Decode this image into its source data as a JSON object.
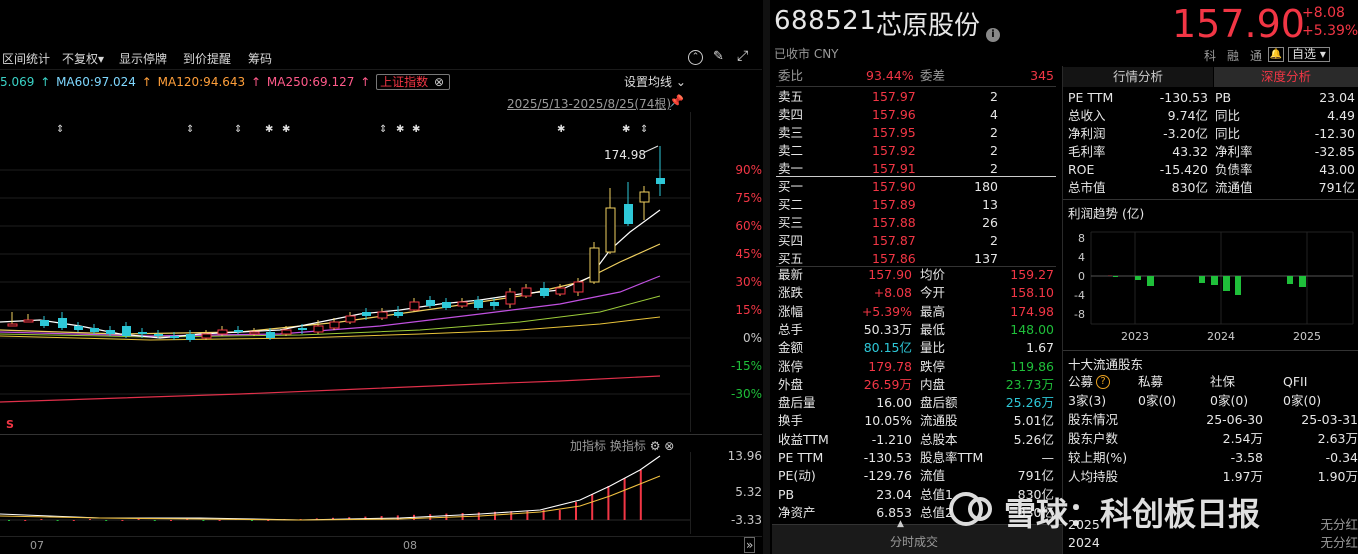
{
  "toolbar": {
    "items": [
      "区间统计",
      "不复权",
      "显示停牌",
      "到价提醒",
      "筹码"
    ],
    "not_adjusted_arrow": "▾"
  },
  "ma_legend": {
    "ma_prev": "5.069",
    "ma60": "MA60:97.024",
    "ma120": "MA120:94.643",
    "ma250": "MA250:69.127",
    "index_btn": "上证指数",
    "settings": "设置均线"
  },
  "chart": {
    "range_label": "2025/5/13-2025/8/25(74根)",
    "high_label": "174.98",
    "pct_ticks": [
      "90%",
      "75%",
      "60%",
      "45%",
      "30%",
      "15%",
      "0%",
      "-15%",
      "-30%"
    ],
    "indicator_buttons": [
      "加指标",
      "换指标"
    ],
    "sub_ticks": [
      "13.96",
      "5.32",
      "-3.33"
    ],
    "x_labels": [
      "07",
      "08"
    ],
    "s_mark": "S"
  },
  "quote": {
    "code": "688521",
    "name": "芯原股份",
    "status": "已收市 CNY",
    "price": "157.90",
    "change": "+8.08",
    "change_pct": "+5.39%",
    "tags": [
      "科",
      "融",
      "通"
    ],
    "watchlist": "自选"
  },
  "order_book": {
    "weibi_label": "委比",
    "weibi_val": "93.44%",
    "weicha_label": "委差",
    "weicha_val": "345",
    "asks": [
      {
        "label": "卖五",
        "price": "157.97",
        "vol": "2"
      },
      {
        "label": "卖四",
        "price": "157.96",
        "vol": "4"
      },
      {
        "label": "卖三",
        "price": "157.95",
        "vol": "2"
      },
      {
        "label": "卖二",
        "price": "157.92",
        "vol": "2"
      },
      {
        "label": "卖一",
        "price": "157.91",
        "vol": "2"
      }
    ],
    "bids": [
      {
        "label": "买一",
        "price": "157.90",
        "vol": "180"
      },
      {
        "label": "买二",
        "price": "157.89",
        "vol": "13"
      },
      {
        "label": "买三",
        "price": "157.88",
        "vol": "26"
      },
      {
        "label": "买四",
        "price": "157.87",
        "vol": "2"
      },
      {
        "label": "买五",
        "price": "157.86",
        "vol": "137"
      }
    ]
  },
  "stats": [
    {
      "l1": "最新",
      "v1": "157.90",
      "c1": "red",
      "l2": "均价",
      "v2": "159.27",
      "c2": "red"
    },
    {
      "l1": "涨跌",
      "v1": "+8.08",
      "c1": "red",
      "l2": "今开",
      "v2": "158.10",
      "c2": "red"
    },
    {
      "l1": "涨幅",
      "v1": "+5.39%",
      "c1": "red",
      "l2": "最高",
      "v2": "174.98",
      "c2": "red"
    },
    {
      "l1": "总手",
      "v1": "50.33万",
      "c1": "white",
      "l2": "最低",
      "v2": "148.00",
      "c2": "green"
    },
    {
      "l1": "金额",
      "v1": "80.15亿",
      "c1": "cyan",
      "l2": "量比",
      "v2": "1.67",
      "c2": "white"
    },
    {
      "l1": "涨停",
      "v1": "179.78",
      "c1": "red",
      "l2": "跌停",
      "v2": "119.86",
      "c2": "green"
    },
    {
      "l1": "外盘",
      "v1": "26.59万",
      "c1": "red",
      "l2": "内盘",
      "v2": "23.73万",
      "c2": "green"
    },
    {
      "l1": "盘后量",
      "v1": "16.00",
      "c1": "white",
      "l2": "盘后额",
      "v2": "25.26万",
      "c2": "cyan"
    },
    {
      "l1": "换手",
      "v1": "10.05%",
      "c1": "white",
      "l2": "流通股",
      "v2": "5.01亿",
      "c2": "white"
    },
    {
      "l1": "收益TTM",
      "v1": "-1.210",
      "c1": "white",
      "l2": "总股本",
      "v2": "5.26亿",
      "c2": "white"
    },
    {
      "l1": "PE TTM",
      "v1": "-130.53",
      "c1": "white",
      "l2": "股息率TTM",
      "v2": "—",
      "c2": "white"
    },
    {
      "l1": "PE(动)",
      "v1": "-129.76",
      "c1": "white",
      "l2": "流值",
      "v2": "791亿",
      "c2": "white"
    },
    {
      "l1": "PB",
      "v1": "23.04",
      "c1": "white",
      "l2": "总值1",
      "v2": "830亿",
      "c2": "white"
    },
    {
      "l1": "净资产",
      "v1": "6.853",
      "c1": "white",
      "l2": "总值2",
      "v2": "830亿",
      "c2": "white"
    }
  ],
  "time_sales_tab": "分时成交",
  "analysis": {
    "tabs": [
      "行情分析",
      "深度分析"
    ],
    "metrics": [
      {
        "l1": "PE TTM",
        "v1": "-130.53",
        "l2": "PB",
        "v2": "23.04"
      },
      {
        "l1": "总收入",
        "v1": "9.74亿",
        "l2": "同比",
        "v2": "4.49"
      },
      {
        "l1": "净利润",
        "v1": "-3.20亿",
        "l2": "同比",
        "v2": "-12.30"
      },
      {
        "l1": "毛利率",
        "v1": "43.32",
        "l2": "净利率",
        "v2": "-32.85"
      },
      {
        "l1": "ROE",
        "v1": "-15.420",
        "l2": "负债率",
        "v2": "43.00"
      },
      {
        "l1": "总市值",
        "v1": "830亿",
        "l2": "流通值",
        "v2": "791亿"
      }
    ],
    "profit_title": "利润趋势 (亿)",
    "profit_yticks": [
      "8",
      "4",
      "0",
      "-4",
      "-8"
    ],
    "profit_years": [
      "2023",
      "2024",
      "2025"
    ],
    "holders_title": "十大流通股东",
    "holder_types": [
      "公募",
      "私募",
      "社保",
      "QFII"
    ],
    "holder_counts": [
      "3家(3)",
      "0家(0)",
      "0家(0)",
      "0家(0)"
    ],
    "holder_rows": [
      {
        "label": "股东情况",
        "a": "25-06-30",
        "b": "25-03-31"
      },
      {
        "label": "股东户数",
        "a": "2.54万",
        "b": "2.63万"
      },
      {
        "label": "较上期(%)",
        "a": "-3.58",
        "b": "-0.34"
      },
      {
        "label": "人均持股",
        "a": "1.97万",
        "b": "1.90万"
      }
    ],
    "dividend_rows": [
      {
        "year": "2025",
        "val": "无分红"
      },
      {
        "year": "2024",
        "val": "无分红"
      }
    ]
  },
  "watermark": "雪球：科创板日报",
  "colors": {
    "up": "#f23645",
    "down": "#1fbf3a",
    "accent": "#f23645",
    "bg": "#000000"
  }
}
